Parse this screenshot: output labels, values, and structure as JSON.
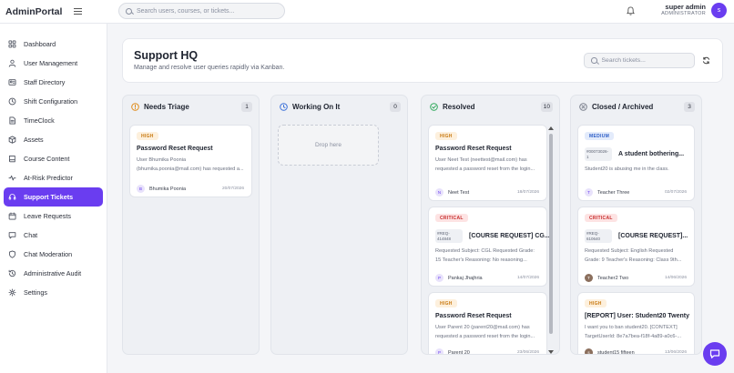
{
  "app": {
    "brand": "AdminPortal"
  },
  "topbar": {
    "search_placeholder": "Search users, courses, or tickets...",
    "user_name": "super admin",
    "user_role": "ADMINISTRATOR",
    "avatar_initial": "s"
  },
  "sidebar": {
    "items": [
      {
        "label": "Dashboard",
        "icon": "grid-icon"
      },
      {
        "label": "User Management",
        "icon": "user-icon"
      },
      {
        "label": "Staff Directory",
        "icon": "id-card-icon"
      },
      {
        "label": "Shift Configuration",
        "icon": "clock-icon"
      },
      {
        "label": "TimeClock",
        "icon": "document-icon"
      },
      {
        "label": "Assets",
        "icon": "box-icon"
      },
      {
        "label": "Course Content",
        "icon": "book-icon"
      },
      {
        "label": "At-Risk Predictor",
        "icon": "pulse-icon"
      },
      {
        "label": "Support Tickets",
        "icon": "headset-icon",
        "active": true
      },
      {
        "label": "Leave Requests",
        "icon": "calendar-icon"
      },
      {
        "label": "Chat",
        "icon": "chat-icon"
      },
      {
        "label": "Chat Moderation",
        "icon": "shield-icon"
      },
      {
        "label": "Administrative Audit",
        "icon": "history-icon"
      },
      {
        "label": "Settings",
        "icon": "gear-icon"
      }
    ]
  },
  "header": {
    "title": "Support HQ",
    "subtitle": "Manage and resolve user queries rapidly via Kanban.",
    "search_placeholder": "Search tickets..."
  },
  "columns": [
    {
      "title": "Needs Triage",
      "count": "1",
      "color": "#e08a17",
      "cards": [
        {
          "priority": "HIGH",
          "title": "Password Reset Request",
          "body": "User Bhumika Poonia (bhumika.poonia@mail.com) has requested a...",
          "user": "Bhumika Poonia",
          "initial": "B",
          "date": "20/07/2026"
        }
      ]
    },
    {
      "title": "Working On It",
      "count": "0",
      "color": "#3a6fd8",
      "drop_label": "Drop here",
      "cards": []
    },
    {
      "title": "Resolved",
      "count": "10",
      "color": "#2ea85a",
      "cards": [
        {
          "priority": "HIGH",
          "title": "Password Reset Request",
          "body": "User Neet Test (neettest@mail.com) has requested a password reset from the login...",
          "user": "Neet Test",
          "initial": "N",
          "date": "18/07/2026"
        },
        {
          "priority": "CRITICAL",
          "ref": "#REQ-414848",
          "title": "[COURSE REQUEST] CG...",
          "body": "Requested Subject: CGL Requested Grade: 15 Teacher's Reasoning: No reasoning...",
          "user": "Pankaj Jhajhria",
          "initial": "P",
          "date": "14/07/2026"
        },
        {
          "priority": "HIGH",
          "title": "Password Reset Request",
          "body": "User Parent 20 (parent20@mail.com) has requested a password reset from the login...",
          "user": "Parent 20",
          "initial": "P",
          "date": "23/06/2026"
        }
      ]
    },
    {
      "title": "Closed / Archived",
      "count": "3",
      "color": "#7a7f8c",
      "cards": [
        {
          "priority": "MEDIUM",
          "ref": "#00073026-1",
          "title": "A student bothering...",
          "body": "Student20 is abusing me in the class.",
          "user": "Teacher Three",
          "initial": "T",
          "date": "02/07/2026"
        },
        {
          "priority": "CRITICAL",
          "ref": "#REQ-610640",
          "title": "[COURSE REQUEST]...",
          "body": "Requested Subject: English Requested Grade: 9 Teacher's Reasoning: Class 9th...",
          "user": "Teacher2 Two",
          "initial": "T",
          "date": "14/06/2026"
        },
        {
          "priority": "HIGH",
          "title": "[REPORT] User: Student20 Twenty",
          "body": "I want you to ban student20. [CONTEXT] TargetUserId: 8e7a7bea-f18f-4a89-a0c6-...",
          "user": "student15 fifteen",
          "initial": "s",
          "date": "13/06/2026"
        }
      ]
    }
  ]
}
